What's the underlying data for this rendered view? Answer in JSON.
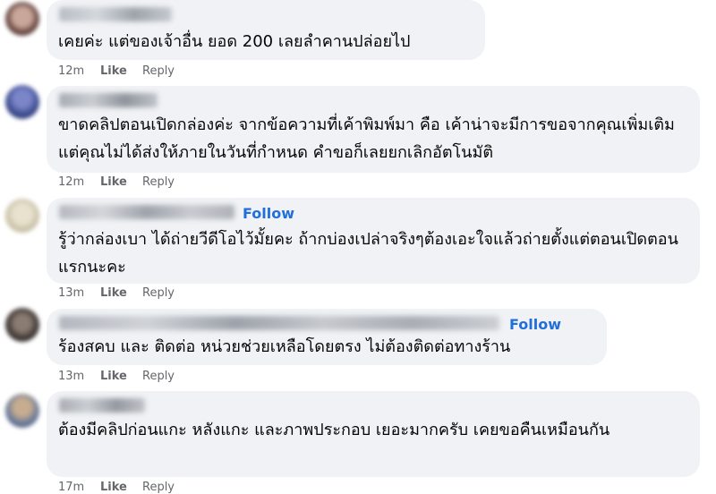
{
  "comments": [
    {
      "text": "เคยค่ะ แต่ของเจ้าอื่น ยอด 200 เลยลำคานปล่อยไป",
      "time": "12m",
      "like": "Like",
      "reply": "Reply",
      "follow": ""
    },
    {
      "text": "ขาดคลิปตอนเปิดกล่องค่ะ จากข้อความที่เค้าพิมพ์มา คือ เค้าน่าจะมีการขอจากคุณเพิ่มเติม แต่คุณไม่ได้ส่งให้ภายในวันที่กำหนด คำขอก็เลยยกเลิกอัตโนมัติ",
      "time": "12m",
      "like": "Like",
      "reply": "Reply",
      "follow": ""
    },
    {
      "text": "รู้ว่ากล่องเบา ได้ถ่ายวีดีโอไว้มั้ยคะ ถ้ากบ่องเปล่าจริงๆต้องเอะใจแล้วถ่ายตั้งแต่ตอนเปิดตอนแรกนะคะ",
      "time": "13m",
      "like": "Like",
      "reply": "Reply",
      "follow": "Follow"
    },
    {
      "text": "ร้องสคบ และ ติดต่อ หน่วยช่วยเหลือโดยตรง ไม่ต้องติดต่อทางร้าน",
      "time": "13m",
      "like": "Like",
      "reply": "Reply",
      "follow": "Follow"
    },
    {
      "text": "ต้องมีคลิปก่อนแกะ หลังแกะ และภาพประกอบ เยอะมากครับ เคยขอคืนเหมือนกัน",
      "time": "17m",
      "like": "Like",
      "reply": "Reply",
      "follow": ""
    }
  ],
  "colors": {
    "bubble": "#f0f2f5",
    "follow": "#216fdb",
    "meta": "#65676b"
  }
}
